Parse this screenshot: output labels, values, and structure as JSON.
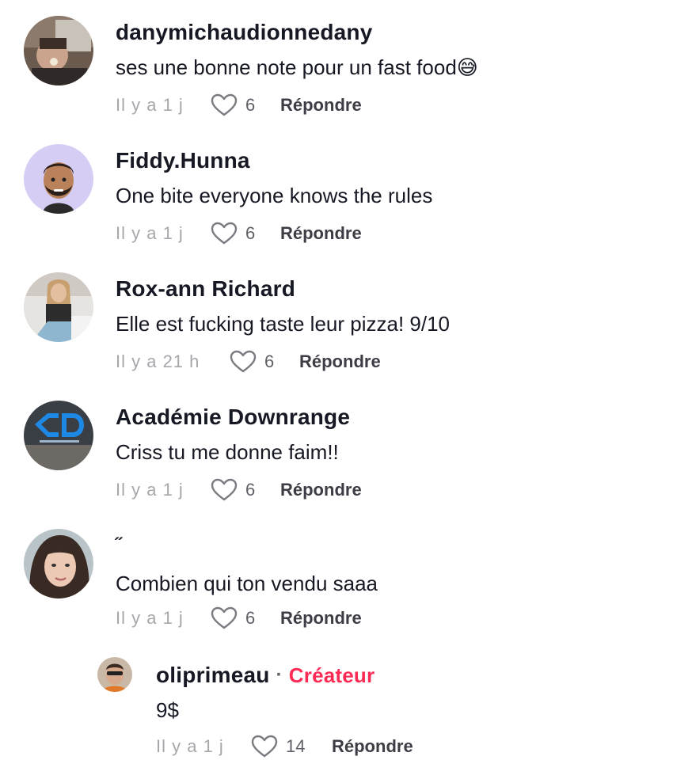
{
  "comments": [
    {
      "username": "danymichaudionnedany",
      "text": "ses une bonne note pour un fast food😅",
      "time": "Il y a 1 j",
      "likes": "6",
      "reply": "Répondre"
    },
    {
      "username": "Fiddy.Hunna",
      "text": "One bite everyone knows the rules",
      "time": "Il y a 1 j",
      "likes": "6",
      "reply": "Répondre"
    },
    {
      "username": "Rox-ann Richard",
      "text": "Elle est fucking taste leur pizza! 9/10",
      "time": "Il y a 21 h",
      "likes": "6",
      "reply": "Répondre"
    },
    {
      "username": "Académie Downrange",
      "text": "Criss tu me donne faim!!",
      "time": "Il y a 1 j",
      "likes": "6",
      "reply": "Répondre"
    },
    {
      "username": "˝",
      "text": "Combien qui ton vendu saaa",
      "time": "Il y a 1 j",
      "likes": "6",
      "reply": "Répondre"
    }
  ],
  "reply_thread": {
    "username": "oliprimeau",
    "separator": "·",
    "badge": "Créateur",
    "text": "9$",
    "time": "Il y a 1 j",
    "likes": "14",
    "reply": "Répondre"
  },
  "colors": {
    "creator_badge": "#fe2c55",
    "meta_gray": "#a6a7ab",
    "text": "#161823"
  }
}
